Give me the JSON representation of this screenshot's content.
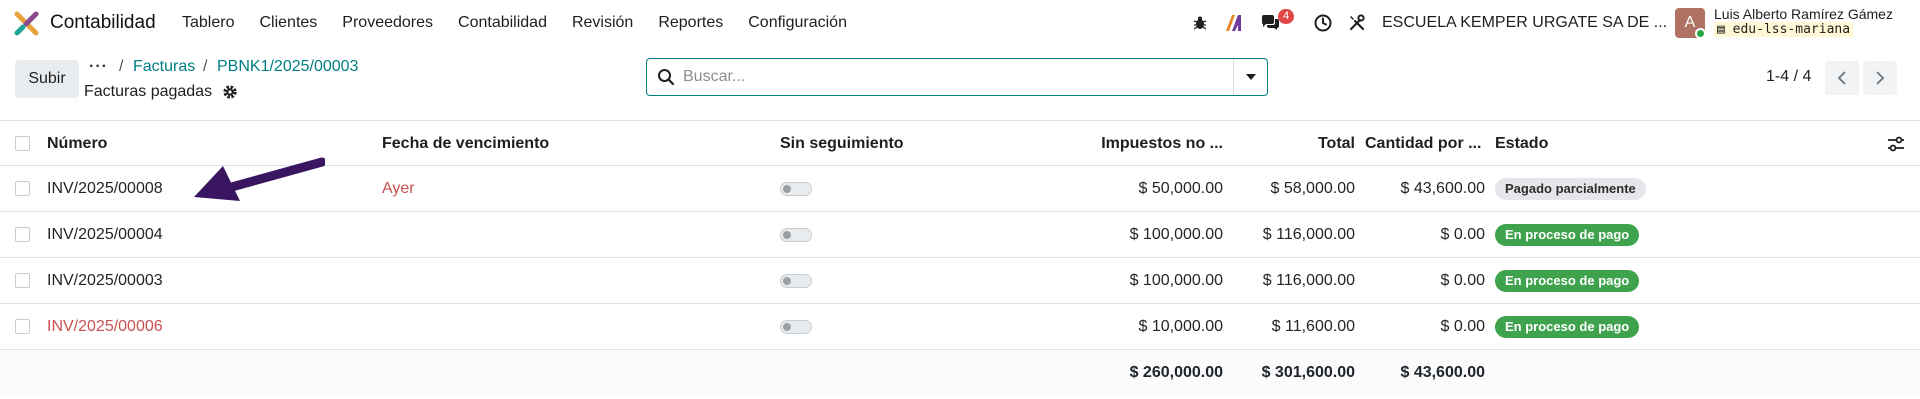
{
  "app": {
    "name": "Contabilidad"
  },
  "menu": [
    "Tablero",
    "Clientes",
    "Proveedores",
    "Contabilidad",
    "Revisión",
    "Reportes",
    "Configuración"
  ],
  "systray": {
    "chat_count": "4",
    "company": "ESCUELA KEMPER URGATE SA DE ...",
    "avatar_letter": "A",
    "user_name": "Luis Alberto Ramírez Gámez",
    "database": "edu-lss-mariana"
  },
  "control": {
    "upload_label": "Subir",
    "breadcrumb_more": "···",
    "breadcrumb": [
      "Facturas",
      "PBNK1/2025/00003"
    ],
    "view_title": "Facturas pagadas",
    "search_placeholder": "Buscar...",
    "pager": "1-4 / 4"
  },
  "table": {
    "headers": {
      "number": "Número",
      "due_date": "Fecha de vencimiento",
      "no_followup": "Sin seguimiento",
      "tax_excluded": "Impuestos no ...",
      "total": "Total",
      "amount_due": "Cantidad por ...",
      "status": "Estado"
    },
    "rows": [
      {
        "number": "INV/2025/00008",
        "due_date": "Ayer",
        "tax_excluded": "$ 50,000.00",
        "total": "$ 58,000.00",
        "amount_due": "$ 43,600.00",
        "status": "Pagado parcialmente",
        "status_kind": "partial",
        "overdue": false
      },
      {
        "number": "INV/2025/00004",
        "due_date": "",
        "tax_excluded": "$ 100,000.00",
        "total": "$ 116,000.00",
        "amount_due": "$ 0.00",
        "status": "En proceso de pago",
        "status_kind": "in_payment",
        "overdue": false
      },
      {
        "number": "INV/2025/00003",
        "due_date": "",
        "tax_excluded": "$ 100,000.00",
        "total": "$ 116,000.00",
        "amount_due": "$ 0.00",
        "status": "En proceso de pago",
        "status_kind": "in_payment",
        "overdue": false
      },
      {
        "number": "INV/2025/00006",
        "due_date": "",
        "tax_excluded": "$ 10,000.00",
        "total": "$ 11,600.00",
        "amount_due": "$ 0.00",
        "status": "En proceso de pago",
        "status_kind": "in_payment",
        "overdue": true
      }
    ],
    "totals": {
      "tax_excluded": "$ 260,000.00",
      "total": "$ 301,600.00",
      "amount_due": "$ 43,600.00"
    }
  },
  "colors": {
    "accent": "#017e84",
    "overdue_red": "#c8514f",
    "status_green": "#3fa34d",
    "status_grey": "#e4e6e9",
    "annotation_arrow": "#3b1660"
  },
  "icons": [
    "app-logo-icon",
    "bug-icon",
    "ai-icon",
    "chat-icon",
    "clock-icon",
    "tools-icon",
    "gear-icon",
    "search-icon",
    "caret-down-icon",
    "chevron-left-icon",
    "chevron-right-icon",
    "column-adjust-icon",
    "arrow-annotation-icon",
    "database-icon"
  ]
}
